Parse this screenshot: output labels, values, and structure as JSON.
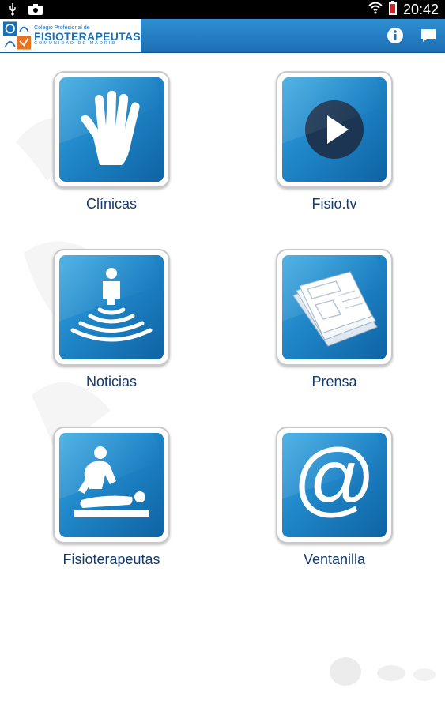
{
  "status_bar": {
    "time": "20:42",
    "icons": [
      "usb-icon",
      "camera-icon",
      "wifi-icon",
      "battery-icon"
    ]
  },
  "action_bar": {
    "logo": {
      "line1": "Colegio Profesional de",
      "line2": "FISIOTERAPEUTAS",
      "line3": "COMUNIDAD DE MADRID"
    },
    "actions": [
      "info-icon",
      "chat-icon"
    ]
  },
  "tiles": [
    {
      "label": "Clínicas",
      "icon": "hand-icon"
    },
    {
      "label": "Fisio.tv",
      "icon": "play-icon"
    },
    {
      "label": "Noticias",
      "icon": "broadcast-person-icon"
    },
    {
      "label": "Prensa",
      "icon": "newspaper-icon"
    },
    {
      "label": "Fisioterapeutas",
      "icon": "massage-icon"
    },
    {
      "label": "Ventanilla",
      "icon": "at-icon"
    }
  ],
  "colors": {
    "accent": "#1d6fb4",
    "tile_blue": "#1f86c8",
    "label": "#153a6e"
  }
}
